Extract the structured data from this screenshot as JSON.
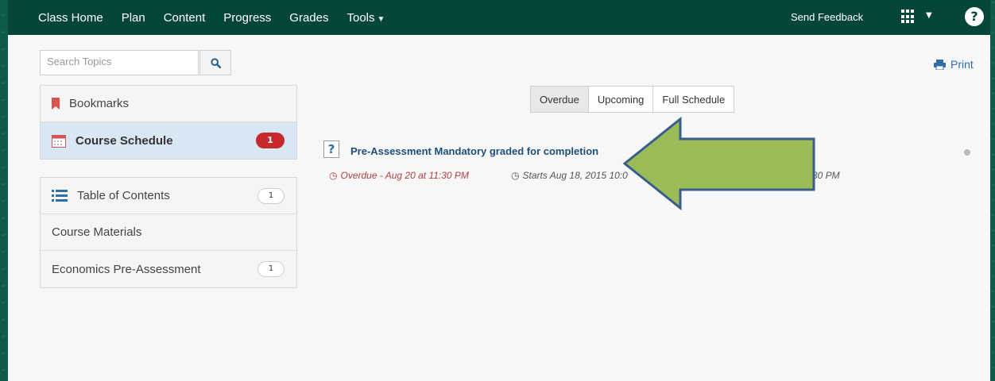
{
  "topnav": {
    "items": [
      {
        "label": "Class Home"
      },
      {
        "label": "Plan"
      },
      {
        "label": "Content"
      },
      {
        "label": "Progress"
      },
      {
        "label": "Grades"
      },
      {
        "label": "Tools"
      }
    ],
    "send_feedback": "Send Feedback",
    "help_label": "?"
  },
  "search": {
    "placeholder": "Search Topics"
  },
  "sidebar": {
    "bookmarks_label": "Bookmarks",
    "course_schedule_label": "Course Schedule",
    "course_schedule_count": "1",
    "toc_label": "Table of Contents",
    "toc_count": "1",
    "modules": [
      {
        "label": "Course Materials"
      },
      {
        "label": "Economics Pre-Assessment",
        "count": "1"
      }
    ]
  },
  "toolbar": {
    "print_label": "Print"
  },
  "tabs": [
    {
      "label": "Overdue",
      "active": true
    },
    {
      "label": "Upcoming",
      "active": false
    },
    {
      "label": "Full Schedule",
      "active": false
    }
  ],
  "event": {
    "icon_label": "?",
    "title": "Pre-Assessment Mandatory graded for completion",
    "overdue": "Overdue - Aug 20 at 11:30 PM",
    "starts": "Starts Aug 18, 2015 10:0",
    "ends_fragment": "30 PM"
  },
  "colors": {
    "topbar": "#06463a",
    "active_row": "#d9e7f4",
    "badge": "#c62a2a",
    "link": "#1d4f7a",
    "overdue": "#b34040",
    "arrow_fill": "#9bbb59",
    "arrow_stroke": "#385d8a"
  }
}
